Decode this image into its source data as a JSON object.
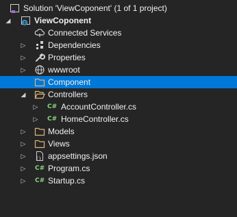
{
  "solution": {
    "label": "Solution 'ViewCoponent' (1 of 1 project)",
    "icon": "solution-icon"
  },
  "project": {
    "label": "ViewCoponent",
    "icon": "web-project-icon"
  },
  "items": [
    {
      "label": "Connected Services",
      "icon": "cloud-connected-icon"
    },
    {
      "label": "Dependencies",
      "icon": "dependencies-icon"
    },
    {
      "label": "Properties",
      "icon": "wrench-icon"
    },
    {
      "label": "wwwroot",
      "icon": "globe-icon"
    },
    {
      "label": "Component",
      "icon": "folder-icon"
    },
    {
      "label": "Controllers",
      "icon": "folder-open-icon"
    },
    {
      "label": "AccountController.cs",
      "icon": "csharp-file-icon",
      "badge": "C#"
    },
    {
      "label": "HomeController.cs",
      "icon": "csharp-file-icon",
      "badge": "C#"
    },
    {
      "label": "Models",
      "icon": "folder-icon"
    },
    {
      "label": "Views",
      "icon": "folder-icon"
    },
    {
      "label": "appsettings.json",
      "icon": "json-file-icon"
    },
    {
      "label": "Program.cs",
      "icon": "csharp-file-icon",
      "badge": "C#"
    },
    {
      "label": "Startup.cs",
      "icon": "csharp-file-icon",
      "badge": "C#"
    }
  ],
  "colors": {
    "background": "#252526",
    "selection": "#0078d7",
    "folder": "#dcb67a",
    "csharp": "#8cd47e",
    "solution_accent": "#9b6fcf",
    "web_accent": "#3f9ddd"
  }
}
